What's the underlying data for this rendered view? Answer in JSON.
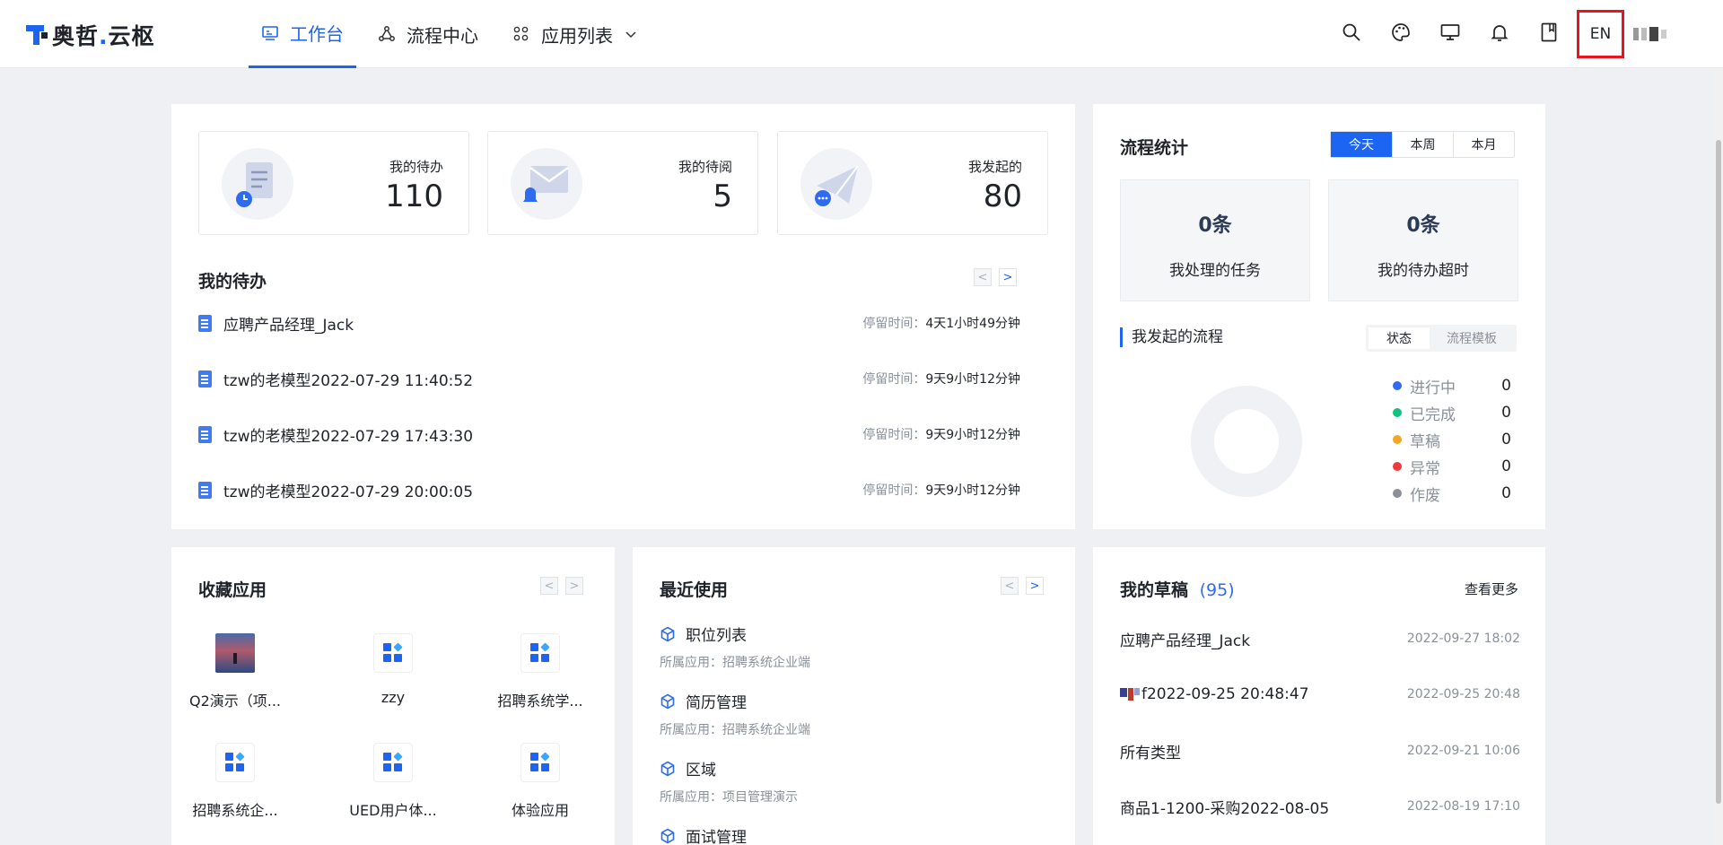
{
  "header": {
    "logo_text_main": "奥哲",
    "logo_dot": ".",
    "logo_text_tail": "云枢",
    "nav": [
      {
        "label": "工作台",
        "icon": "monitor-icon",
        "active": true
      },
      {
        "label": "流程中心",
        "icon": "workflow-icon",
        "active": false
      },
      {
        "label": "应用列表",
        "icon": "apps-grid-icon",
        "active": false
      }
    ],
    "tools": [
      "search-icon",
      "palette-icon",
      "desktop-icon",
      "bell-icon",
      "book-icon"
    ],
    "lang_button": "EN"
  },
  "stats": [
    {
      "label": "我的待办",
      "value": "110",
      "icon": "todo-list-icon"
    },
    {
      "label": "我的待阅",
      "value": "5",
      "icon": "mail-icon"
    },
    {
      "label": "我发起的",
      "value": "80",
      "icon": "paper-plane-icon"
    }
  ],
  "todo": {
    "title": "我的待办",
    "time_label": "停留时间：",
    "items": [
      {
        "title": "应聘产品经理_Jack",
        "time": "4天1小时49分钟"
      },
      {
        "title": "tzw的老模型2022-07-29 11:40:52",
        "time": "9天9小时12分钟"
      },
      {
        "title": "tzw的老模型2022-07-29 17:43:30",
        "time": "9天9小时12分钟"
      },
      {
        "title": "tzw的老模型2022-07-29 20:00:05",
        "time": "9天9小时12分钟"
      }
    ]
  },
  "flow_stats": {
    "title": "流程统计",
    "periods": [
      "今天",
      "本周",
      "本月"
    ],
    "active_period": "今天",
    "metrics": [
      {
        "value": "0条",
        "label": "我处理的任务"
      },
      {
        "value": "0条",
        "label": "我的待办超时"
      }
    ],
    "initiated_title": "我发起的流程",
    "view_tabs": [
      "状态",
      "流程模板"
    ],
    "active_view": "状态",
    "legend": [
      {
        "name": "进行中",
        "value": "0",
        "color": "#2f6bef"
      },
      {
        "name": "已完成",
        "value": "0",
        "color": "#13c27f"
      },
      {
        "name": "草稿",
        "value": "0",
        "color": "#f5a623"
      },
      {
        "name": "异常",
        "value": "0",
        "color": "#f0393c"
      },
      {
        "name": "作废",
        "value": "0",
        "color": "#8a8f99"
      }
    ]
  },
  "favorites": {
    "title": "收藏应用",
    "items": [
      {
        "label": "Q2演示（项...",
        "icon": "photo-thumbnail-icon"
      },
      {
        "label": "zzy",
        "icon": "app-grid-icon"
      },
      {
        "label": "招聘系统学...",
        "icon": "app-grid-icon"
      },
      {
        "label": "招聘系统企...",
        "icon": "app-grid-icon"
      },
      {
        "label": "UED用户体...",
        "icon": "app-grid-icon"
      },
      {
        "label": "体验应用",
        "icon": "app-grid-icon"
      }
    ]
  },
  "recent": {
    "title": "最近使用",
    "app_prefix": "所属应用：",
    "items": [
      {
        "name": "职位列表",
        "app": "招聘系统企业端"
      },
      {
        "name": "简历管理",
        "app": "招聘系统企业端"
      },
      {
        "name": "区域",
        "app": "项目管理演示"
      },
      {
        "name": "面试管理",
        "app": ""
      }
    ]
  },
  "drafts": {
    "title": "我的草稿",
    "count": "(95)",
    "more": "查看更多",
    "items": [
      {
        "name": "应聘产品经理_Jack",
        "date": "2022-09-27 18:02"
      },
      {
        "name": "f2022-09-25 20:48:47",
        "date": "2022-09-25 20:48"
      },
      {
        "name": "所有类型",
        "date": "2022-09-21 10:06"
      },
      {
        "name": "商品1-1200-采购2022-08-05",
        "date": "2022-08-19 17:10"
      }
    ]
  },
  "colors": {
    "accent": "#1c64f2",
    "highlight_border": "#e8141e"
  }
}
